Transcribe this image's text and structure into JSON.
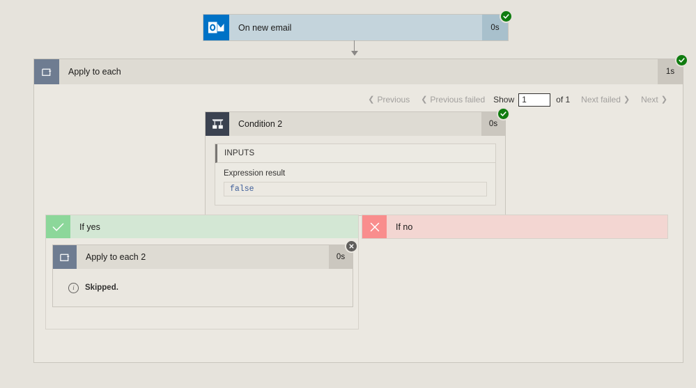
{
  "trigger": {
    "title": "On new email",
    "duration": "0s",
    "icon": "outlook-icon",
    "status": "succeeded",
    "body_color": "#c4d4dc",
    "icon_color": "#0072c6",
    "success_color": "#107c10"
  },
  "scope": {
    "title": "Apply to each",
    "duration": "1s",
    "icon": "loop-icon",
    "status": "succeeded"
  },
  "pager": {
    "previous": "Previous",
    "previous_failed": "Previous failed",
    "show_label": "Show",
    "page_value": "1",
    "page_placeholder": "1",
    "of_label": "of 1",
    "next_failed": "Next failed",
    "next": "Next"
  },
  "condition": {
    "title": "Condition 2",
    "duration": "0s",
    "icon": "condition-icon",
    "status": "succeeded",
    "inputs_header": "INPUTS",
    "field_label": "Expression result",
    "field_value": "false",
    "value_color": "#3f5f9a"
  },
  "branches": {
    "yes": {
      "label": "If yes",
      "icon": "checkmark-icon",
      "accent": "#8cd79a",
      "body": "#d3e7d4"
    },
    "no": {
      "label": "If no",
      "icon": "cross-icon",
      "accent": "#f98d8d",
      "body": "#f3d6d2"
    }
  },
  "nested_action": {
    "title": "Apply to each 2",
    "duration": "0s",
    "icon": "loop-icon",
    "status": "skipped",
    "status_text": "Skipped.",
    "status_icon": "info-icon"
  }
}
